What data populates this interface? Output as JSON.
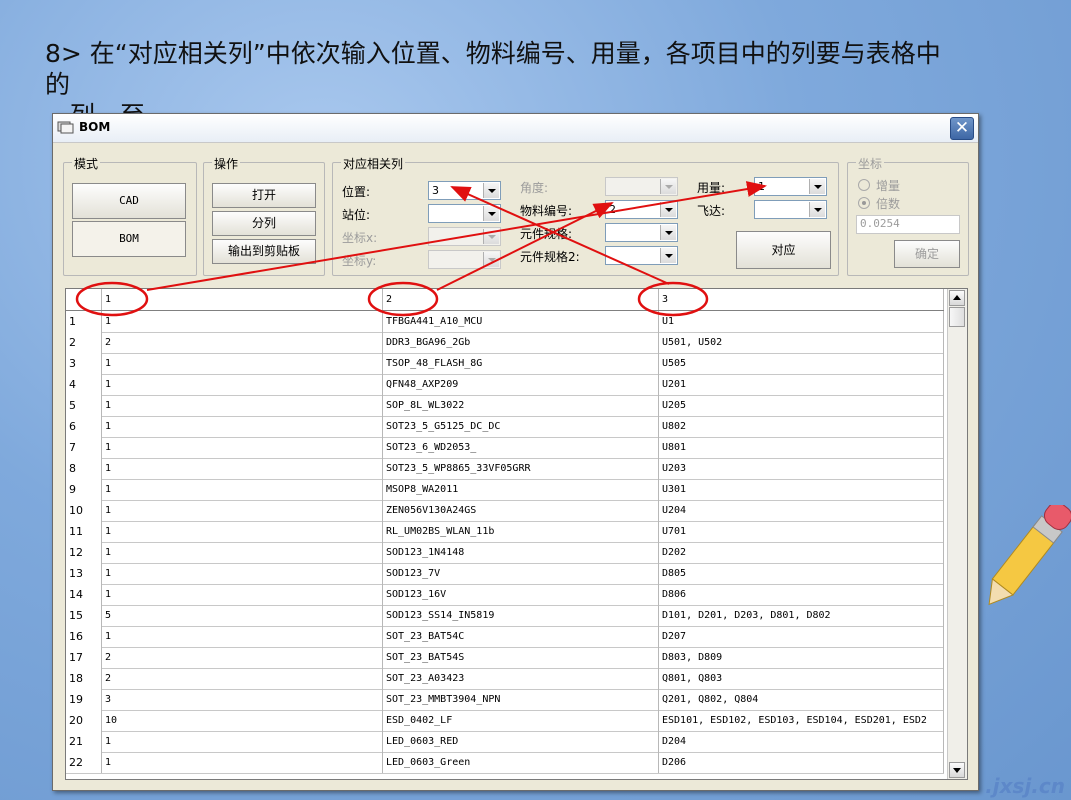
{
  "slide": {
    "instruction_line1": "8> 在“对应相关列”中依次输入位置、物料编号、用量，各项目中的列要与表格中",
    "instruction_line2": "的",
    "instruction_line3": "列一至"
  },
  "window": {
    "title": "BOM",
    "close_label": "✕"
  },
  "mode_group": {
    "label": "模式",
    "cad_label": "CAD",
    "bom_label": "BOM"
  },
  "ops_group": {
    "label": "操作",
    "open_label": "打开",
    "split_label": "分列",
    "export_label": "输出到剪贴板"
  },
  "mapping_group": {
    "label": "对应相关列",
    "position_label": "位置:",
    "position_value": "3",
    "station_label": "站位:",
    "station_value": "",
    "coordx_label": "坐标x:",
    "coordy_label": "坐标y:",
    "angle_label": "角度:",
    "part_no_label": "物料编号:",
    "part_no_value": "2",
    "spec_label": "元件规格:",
    "spec2_label": "元件规格2:",
    "qty_label": "用量:",
    "qty_value": "1",
    "feeder_label": "飞达:",
    "apply_label": "对应"
  },
  "coord_group": {
    "label": "坐标",
    "increment_label": "增量",
    "multiple_label": "倍数",
    "factor_value": "0.0254",
    "ok_label": "确定"
  },
  "table": {
    "columns": [
      "1",
      "2",
      "3"
    ],
    "rows": [
      [
        "1",
        "1",
        "TFBGA441_A10_MCU",
        "U1"
      ],
      [
        "2",
        "2",
        "DDR3_BGA96_2Gb",
        "U501, U502"
      ],
      [
        "3",
        "1",
        "TSOP_48_FLASH_8G",
        "U505"
      ],
      [
        "4",
        "1",
        "QFN48_AXP209",
        "U201"
      ],
      [
        "5",
        "1",
        "SOP_8L_WL3022",
        "U205"
      ],
      [
        "6",
        "1",
        "SOT23_5_G5125_DC_DC",
        "U802"
      ],
      [
        "7",
        "1",
        "SOT23_6_WD2053_",
        "U801"
      ],
      [
        "8",
        "1",
        "SOT23_5_WP8865_33VF05GRR",
        "U203"
      ],
      [
        "9",
        "1",
        "MSOP8_WA2011",
        "U301"
      ],
      [
        "10",
        "1",
        "ZEN056V130A24GS",
        "U204"
      ],
      [
        "11",
        "1",
        "RL_UM02BS_WLAN_11b",
        "U701"
      ],
      [
        "12",
        "1",
        "SOD123_1N4148",
        "D202"
      ],
      [
        "13",
        "1",
        "SOD123_7V",
        "D805"
      ],
      [
        "14",
        "1",
        "SOD123_16V",
        "D806"
      ],
      [
        "15",
        "5",
        "SOD123_SS14_IN5819",
        "D101, D201, D203, D801, D802"
      ],
      [
        "16",
        "1",
        "SOT_23_BAT54C",
        "D207"
      ],
      [
        "17",
        "2",
        "SOT_23_BAT54S",
        "D803, D809"
      ],
      [
        "18",
        "2",
        "SOT_23_A03423",
        "Q801, Q803"
      ],
      [
        "19",
        "3",
        "SOT_23_MMBT3904_NPN",
        "Q201, Q802, Q804"
      ],
      [
        "20",
        "10",
        "ESD_0402_LF",
        "ESD101, ESD102, ESD103, ESD104, ESD201, ESD2"
      ],
      [
        "21",
        "1",
        "LED_0603_RED",
        "D204"
      ],
      [
        "22",
        "1",
        "LED_0603_Green",
        "D206"
      ]
    ]
  },
  "colors": {
    "annotation": "#e01010",
    "window_bg": "#ece9d8"
  },
  "watermark": ".jxsj.cn"
}
